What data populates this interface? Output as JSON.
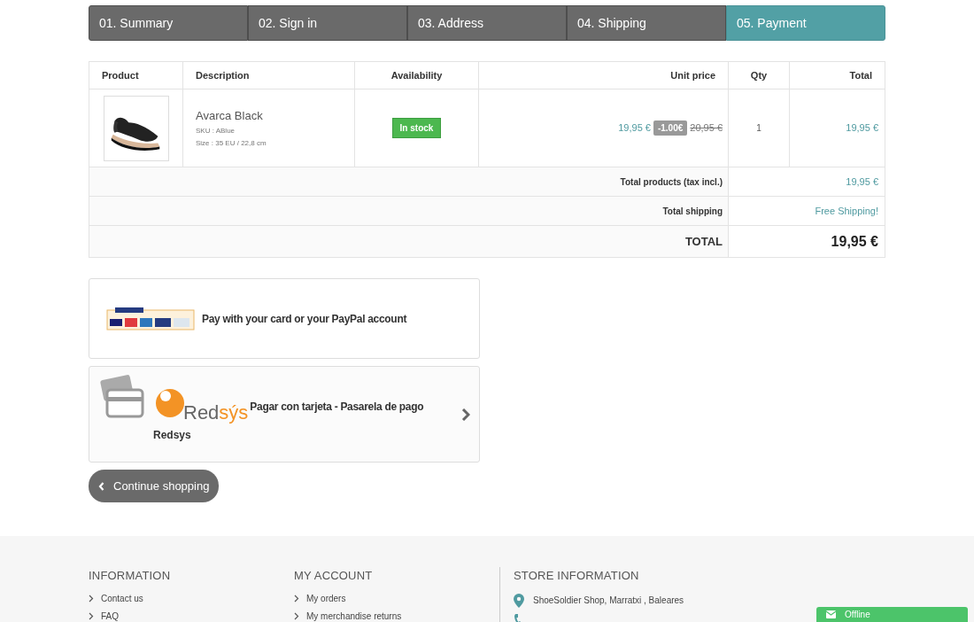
{
  "steps": [
    {
      "label": "01. Summary",
      "selected": false
    },
    {
      "label": "02. Sign in",
      "selected": false
    },
    {
      "label": "03. Address",
      "selected": false
    },
    {
      "label": "04. Shipping",
      "selected": false
    },
    {
      "label": "05. Payment",
      "selected": true
    }
  ],
  "cart": {
    "columns": [
      "Product",
      "Description",
      "Availability",
      "Unit price",
      "Qty",
      "Total"
    ],
    "items": [
      {
        "name": "Avarca Black",
        "sku": "SKU : ABlue",
        "size": "Size : 35 EU / 22,8 cm",
        "availability": "In stock",
        "price": "19,95 €",
        "discount": "-1.00€",
        "old_price": "20,95 €",
        "qty": "1",
        "total": "19,95 €"
      }
    ],
    "summary": [
      {
        "kind": "normal",
        "label": "Total products (tax incl.)",
        "value": "19,95 €"
      },
      {
        "kind": "normal",
        "label": "Total shipping",
        "value": "Free Shipping!"
      },
      {
        "kind": "total",
        "label": "TOTAL",
        "value": "19,95 €"
      }
    ]
  },
  "payment_options": [
    {
      "kind": "paypal",
      "label": "Pay with your card or your PayPal account"
    },
    {
      "kind": "redsys",
      "label": "Pagar con tarjeta - Pasarela de pago",
      "logo": [
        "Red",
        "sýs"
      ],
      "name": "Redsys"
    }
  ],
  "continue_button": "Continue shopping",
  "footer": {
    "columns": [
      {
        "title": "INFORMATION",
        "links": [
          "Contact us",
          "FAQ"
        ]
      },
      {
        "title": "MY ACCOUNT",
        "links": [
          "My orders",
          "My merchandise returns"
        ]
      }
    ],
    "store": {
      "title": "STORE INFORMATION",
      "address": "ShoeSoldier Shop, Marratxi , Baleares"
    }
  },
  "chat": {
    "label": "Offline"
  }
}
